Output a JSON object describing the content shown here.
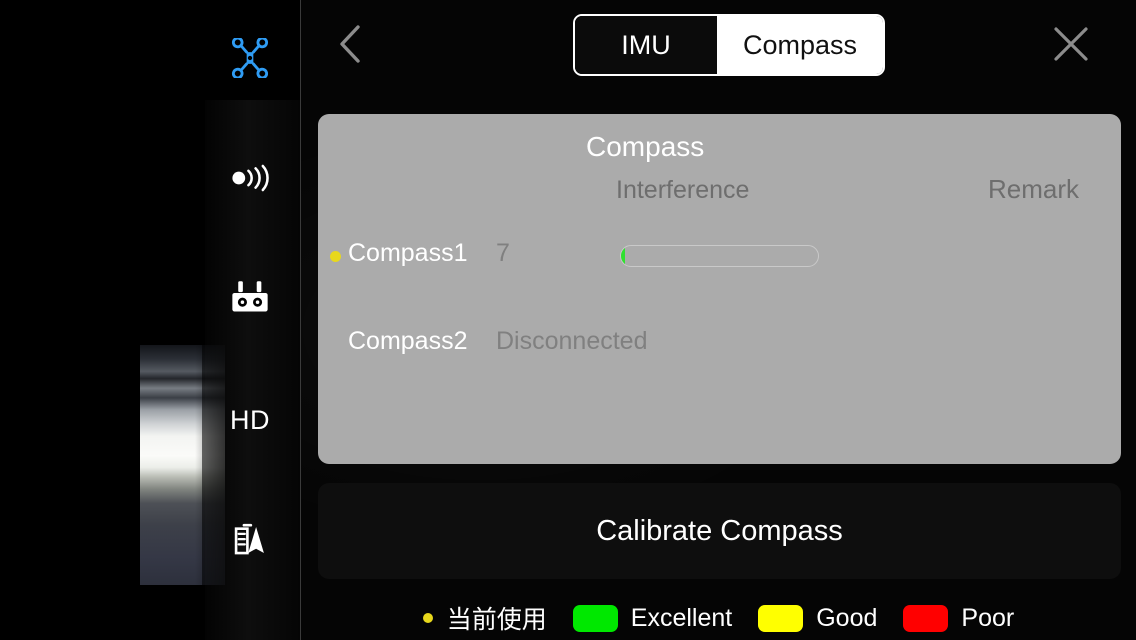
{
  "app": {
    "screen_title": "Compass",
    "background_color": "#000000"
  },
  "sidebar": {
    "items": [
      {
        "id": "aircraft",
        "icon": "drone-icon",
        "label": "",
        "color": "#2f9cf4",
        "active": true
      },
      {
        "id": "transmission",
        "icon": "signal-broadcast-icon",
        "label": "",
        "color": "#ffffff",
        "active": false
      },
      {
        "id": "remote-controller",
        "icon": "remote-controller-icon",
        "label": "",
        "color": "#ffffff",
        "active": false
      },
      {
        "id": "image-transmission",
        "icon": "hd-text-icon",
        "label": "HD",
        "color": "#ffffff",
        "active": false
      },
      {
        "id": "flight-records",
        "icon": "flight-log-icon",
        "label": "",
        "color": "#ffffff",
        "active": false
      }
    ]
  },
  "header": {
    "back_icon": "chevron-left-icon",
    "close_icon": "close-x-icon",
    "tabs": [
      {
        "id": "imu",
        "label": "IMU",
        "selected": false
      },
      {
        "id": "compass",
        "label": "Compass",
        "selected": true
      }
    ]
  },
  "status_card": {
    "title": "Compass",
    "columns": {
      "interference": "Interference",
      "remark": "Remark"
    },
    "rows": [
      {
        "name": "Compass1",
        "value": "7",
        "in_use": true,
        "in_use_color": "#e8d81c",
        "has_bar": true,
        "bar_percent": 2,
        "bar_fill_color": "#2fe02f",
        "remark": ""
      },
      {
        "name": "Compass2",
        "value": "Disconnected",
        "in_use": false,
        "in_use_color": "",
        "has_bar": false,
        "bar_percent": 0,
        "bar_fill_color": "",
        "remark": ""
      }
    ]
  },
  "calibrate": {
    "label": "Calibrate Compass"
  },
  "legend": {
    "current_use": {
      "label": "当前使用",
      "dot_color": "#e8d81c"
    },
    "levels": [
      {
        "label": "Excellent",
        "color": "#00e800"
      },
      {
        "label": "Good",
        "color": "#ffff00"
      },
      {
        "label": "Poor",
        "color": "#ff0000"
      }
    ]
  }
}
